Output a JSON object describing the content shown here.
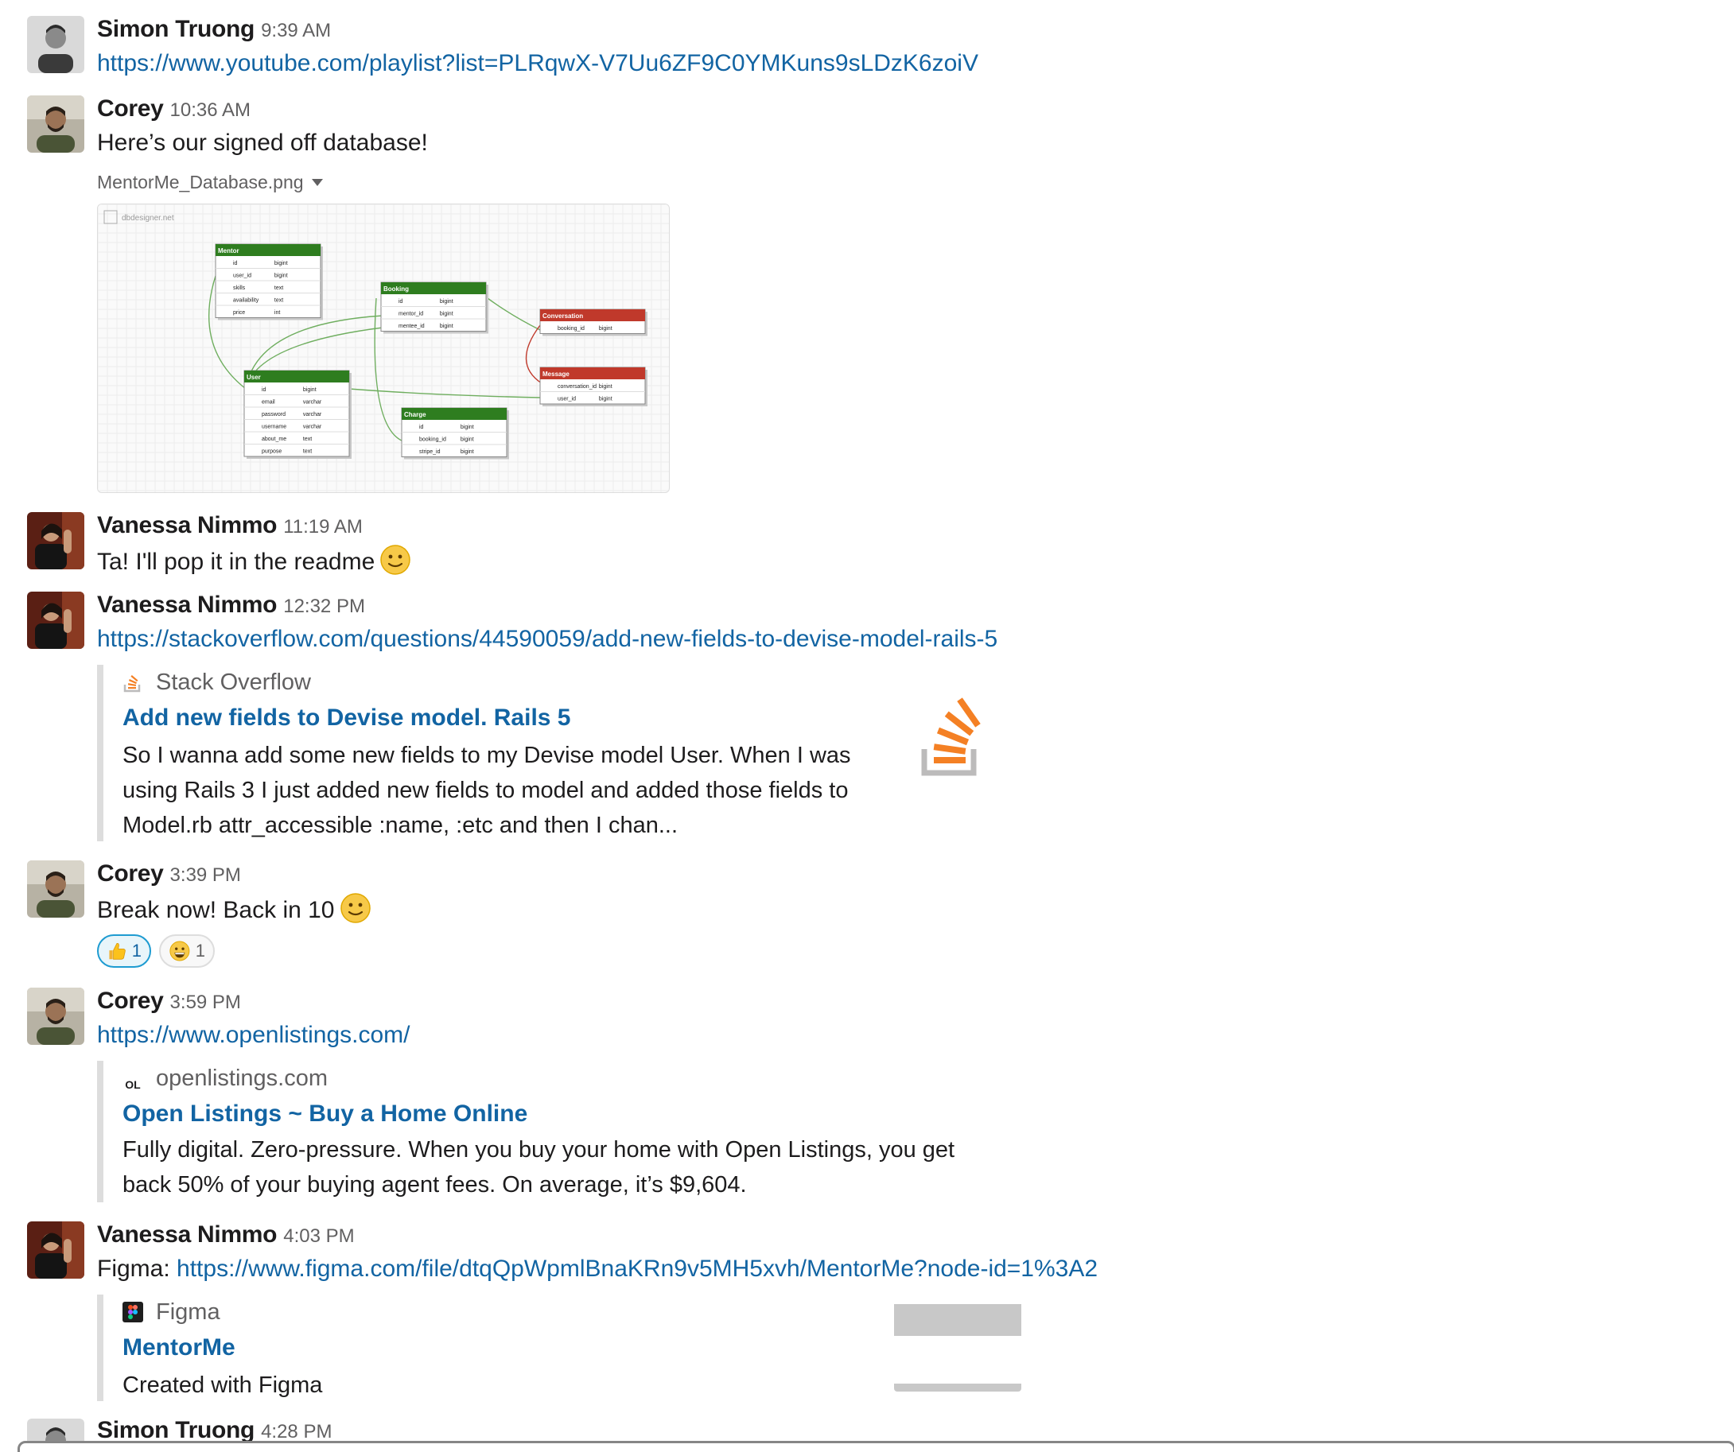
{
  "messages": [
    {
      "author": "Simon Truong",
      "time": "9:39 AM",
      "link": "https://www.youtube.com/playlist?list=PLRqwX-V7Uu6ZF9C0YMKuns9sLDzK6zoiV"
    },
    {
      "author": "Corey",
      "time": "10:36 AM",
      "text": "Here’s our signed off database!",
      "file": {
        "name": "MentorMe_Database.png",
        "watermark": "dbdesigner.net",
        "tables": [
          {
            "title": "Mentor",
            "color": "#2e7d1f",
            "rows": [
              [
                "id",
                "bigint"
              ],
              [
                "user_id",
                "bigint"
              ],
              [
                "skills",
                "text"
              ],
              [
                "availability",
                "text"
              ],
              [
                "price",
                "int"
              ]
            ]
          },
          {
            "title": "Booking",
            "color": "#2e7d1f",
            "rows": [
              [
                "id",
                "bigint"
              ],
              [
                "mentor_id",
                "bigint"
              ],
              [
                "mentee_id",
                "bigint"
              ]
            ]
          },
          {
            "title": "Conversation",
            "color": "#c0392b",
            "rows": [
              [
                "booking_id",
                "bigint"
              ]
            ]
          },
          {
            "title": "Message",
            "color": "#c0392b",
            "rows": [
              [
                "conversation_id",
                "bigint"
              ],
              [
                "user_id",
                "bigint"
              ]
            ]
          },
          {
            "title": "User",
            "color": "#2e7d1f",
            "rows": [
              [
                "id",
                "bigint"
              ],
              [
                "email",
                "varchar"
              ],
              [
                "password",
                "varchar"
              ],
              [
                "username",
                "varchar"
              ],
              [
                "about_me",
                "text"
              ],
              [
                "purpose",
                "text"
              ]
            ]
          },
          {
            "title": "Charge",
            "color": "#2e7d1f",
            "rows": [
              [
                "id",
                "bigint"
              ],
              [
                "booking_id",
                "bigint"
              ],
              [
                "stripe_id",
                "bigint"
              ]
            ]
          }
        ]
      }
    },
    {
      "author": "Vanessa Nimmo",
      "time": "11:19 AM",
      "text": "Ta! I'll pop it in the readme",
      "emoji": "slightly-smiling-face"
    },
    {
      "author": "Vanessa Nimmo",
      "time": "12:32 PM",
      "link": "https://stackoverflow.com/questions/44590059/add-new-fields-to-devise-model-rails-5",
      "unfurl": {
        "service": "Stack Overflow",
        "title": "Add new fields to Devise model. Rails 5",
        "lines": [
          "So I wanna add some new fields to my Devise model User. When I was",
          "using Rails 3 I just added new fields to model and added those fields to",
          "Model.rb attr_accessible :name, :etc and then I chan..."
        ],
        "accent": "#f48024"
      }
    },
    {
      "author": "Corey",
      "time": "3:39 PM",
      "text": "Break now! Back in 10",
      "emoji": "slightly-smiling-face",
      "reactions": [
        {
          "emoji": "thumbs-up",
          "count": "1",
          "active": true
        },
        {
          "emoji": "grinning-face",
          "count": "1",
          "active": false
        }
      ]
    },
    {
      "author": "Corey",
      "time": "3:59 PM",
      "link": "https://www.openlistings.com/",
      "unfurl": {
        "service": "openlistings.com",
        "service_logo": "OL",
        "title": "Open Listings ~ Buy a Home Online",
        "lines": [
          "Fully digital. Zero-pressure. When you buy your home with Open Listings, you get",
          "back 50% of your buying agent fees. On average, it’s $9,604."
        ]
      }
    },
    {
      "author": "Vanessa Nimmo",
      "time": "4:03 PM",
      "prefix": "Figma: ",
      "link": "https://www.figma.com/file/dtqQpWpmlBnaKRn9v5MH5xvh/MentorMe?node-id=1%3A2",
      "unfurl": {
        "service": "Figma",
        "title": "MentorMe",
        "lines": [
          "Created with Figma"
        ]
      }
    },
    {
      "author": "Simon Truong",
      "time": "4:28 PM"
    }
  ],
  "colors": {
    "link": "#1264a3",
    "text": "#1d1c1d",
    "muted": "#616061",
    "attachment_border": "#dddddd"
  }
}
